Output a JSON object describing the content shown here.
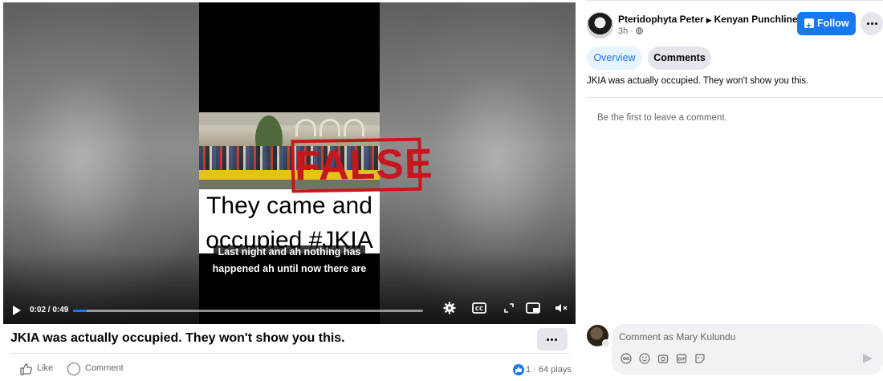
{
  "video": {
    "overlay_stamp": "FALSE",
    "headline_line1": "They came and",
    "headline_line2": "occupied #JKIA",
    "caption_line1": "Last night and ah nothing has",
    "caption_line2": "happened ah until now there are",
    "time": "0:02 / 0:49",
    "progress": 0.04
  },
  "post": {
    "title": "JKIA was actually occupied. They won't show you this.",
    "actions": {
      "like": "Like",
      "comment": "Comment"
    },
    "reactions_plays": "1 · 64 plays"
  },
  "panel": {
    "author": "Pteridophyta Peter",
    "page": "Kenyan Punchline",
    "meta": "3h ·",
    "follow_label": "Follow",
    "tabs": {
      "overview": "Overview",
      "comments": "Comments"
    },
    "description": "JKIA was actually occupied. They won't show you this.",
    "empty_comments": "Be the first to leave a comment.",
    "comment_placeholder": "Comment as Mary Kulundu"
  },
  "colors": {
    "accent": "#1877f2",
    "stamp": "#c8161d",
    "muted": "#65676b"
  },
  "icons": [
    "play-icon",
    "settings-icon",
    "captions-icon",
    "fullscreen-icon",
    "pip-icon",
    "volume-icon",
    "like-icon",
    "comment-icon",
    "globe-icon",
    "avatar-icon",
    "emoji-icon",
    "camera-icon",
    "gif-icon",
    "sticker-icon",
    "send-icon"
  ]
}
